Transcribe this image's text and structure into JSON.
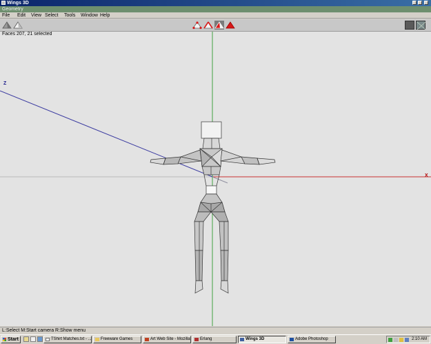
{
  "window": {
    "title": "Wings 3D",
    "geometry_label": "Geometry"
  },
  "menu": {
    "items": [
      "File",
      "Edit",
      "View",
      "Select",
      "Tools",
      "Window",
      "Help"
    ]
  },
  "toolbar": {
    "left_icons": [
      "view-mode-icon",
      "smooth-mode-icon"
    ],
    "select_modes": [
      "vertex-select-icon",
      "edge-select-icon",
      "face-select-icon",
      "body-select-icon"
    ],
    "active_mode": "face-select-icon",
    "accent": "#d81818"
  },
  "viewport": {
    "selection_info": "Faces 207, 21 selected",
    "z_axis_label": "Z",
    "x_axis_label": "X",
    "colors": {
      "x_axis": "#c83030",
      "y_axis": "#40a040",
      "z_axis": "#3a3aa0",
      "background": "#e3e3e3"
    }
  },
  "status": {
    "text": "L:Select  M:Start camera  R:Show menu"
  },
  "taskbar": {
    "start_label": "Start",
    "buttons": [
      "TShirt Matches.txt - ...",
      "Freeware Games",
      "Art Web Site - Mozilla",
      "Erlang",
      "Wings 3D",
      "Adobe Photoshop"
    ],
    "active_button": "Wings 3D",
    "clock": "2:10 AM"
  }
}
